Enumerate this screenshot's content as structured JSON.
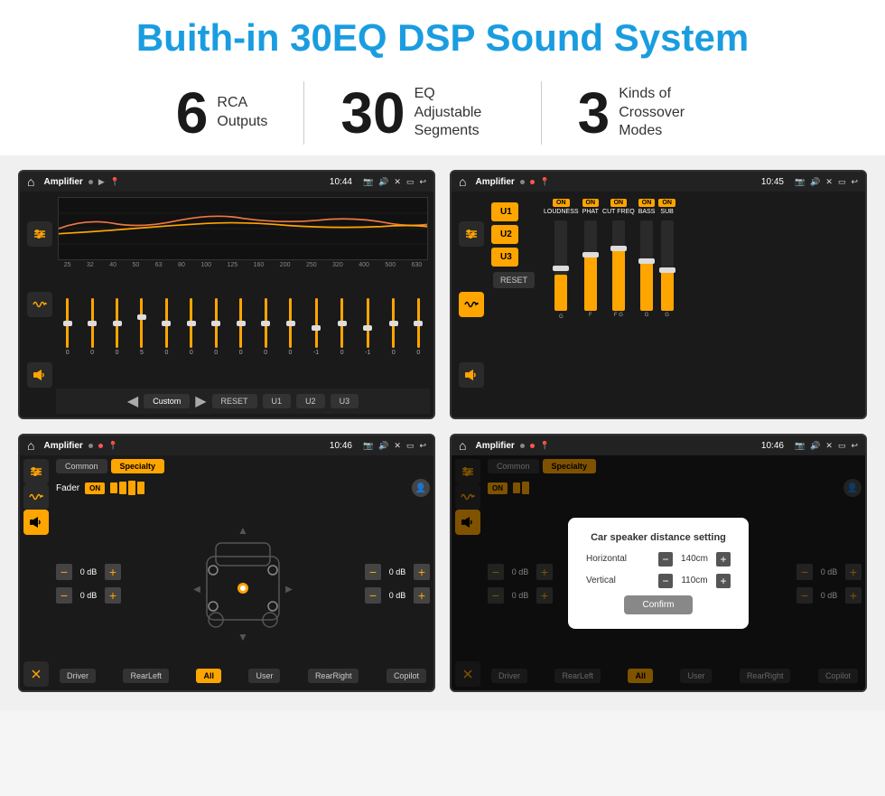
{
  "header": {
    "title": "Buith-in 30EQ DSP Sound System"
  },
  "stats": [
    {
      "number": "6",
      "label_line1": "RCA",
      "label_line2": "Outputs"
    },
    {
      "number": "30",
      "label_line1": "EQ Adjustable",
      "label_line2": "Segments"
    },
    {
      "number": "3",
      "label_line1": "Kinds of",
      "label_line2": "Crossover Modes"
    }
  ],
  "screen1": {
    "status": {
      "title": "Amplifier",
      "time": "10:44"
    },
    "freq_labels": [
      "25",
      "32",
      "40",
      "50",
      "63",
      "80",
      "100",
      "125",
      "160",
      "200",
      "250",
      "320",
      "400",
      "500",
      "630"
    ],
    "slider_values": [
      "0",
      "0",
      "0",
      "5",
      "0",
      "0",
      "0",
      "0",
      "0",
      "0",
      "-1",
      "0",
      "-1"
    ],
    "nav_items": [
      "Custom",
      "RESET",
      "U1",
      "U2",
      "U3"
    ]
  },
  "screen2": {
    "status": {
      "title": "Amplifier",
      "time": "10:45"
    },
    "presets": [
      "U1",
      "U2",
      "U3"
    ],
    "channels": [
      {
        "on": true,
        "name": "LOUDNESS"
      },
      {
        "on": true,
        "name": "PHAT"
      },
      {
        "on": true,
        "name": "CUT FREQ"
      },
      {
        "on": true,
        "name": "BASS"
      },
      {
        "on": true,
        "name": "SUB"
      }
    ],
    "reset_label": "RESET"
  },
  "screen3": {
    "status": {
      "title": "Amplifier",
      "time": "10:46"
    },
    "tabs": [
      "Common",
      "Specialty"
    ],
    "fader_label": "Fader",
    "on_label": "ON",
    "volume_rows": [
      {
        "value": "0 dB"
      },
      {
        "value": "0 dB"
      },
      {
        "value": "0 dB"
      },
      {
        "value": "0 dB"
      }
    ],
    "bottom_btns": [
      "Driver",
      "RearLeft",
      "All",
      "User",
      "RearRight",
      "Copilot"
    ]
  },
  "screen4": {
    "status": {
      "title": "Amplifier",
      "time": "10:46"
    },
    "tabs": [
      "Common",
      "Specialty"
    ],
    "on_label": "ON",
    "dialog": {
      "title": "Car speaker distance setting",
      "row1_label": "Horizontal",
      "row1_value": "140cm",
      "row2_label": "Vertical",
      "row2_value": "110cm",
      "confirm_label": "Confirm"
    },
    "bottom_btns": [
      "Driver",
      "RearLeft",
      "All",
      "User",
      "RearRight",
      "Copilot"
    ],
    "volume_rows": [
      {
        "value": "0 dB"
      },
      {
        "value": "0 dB"
      }
    ]
  }
}
